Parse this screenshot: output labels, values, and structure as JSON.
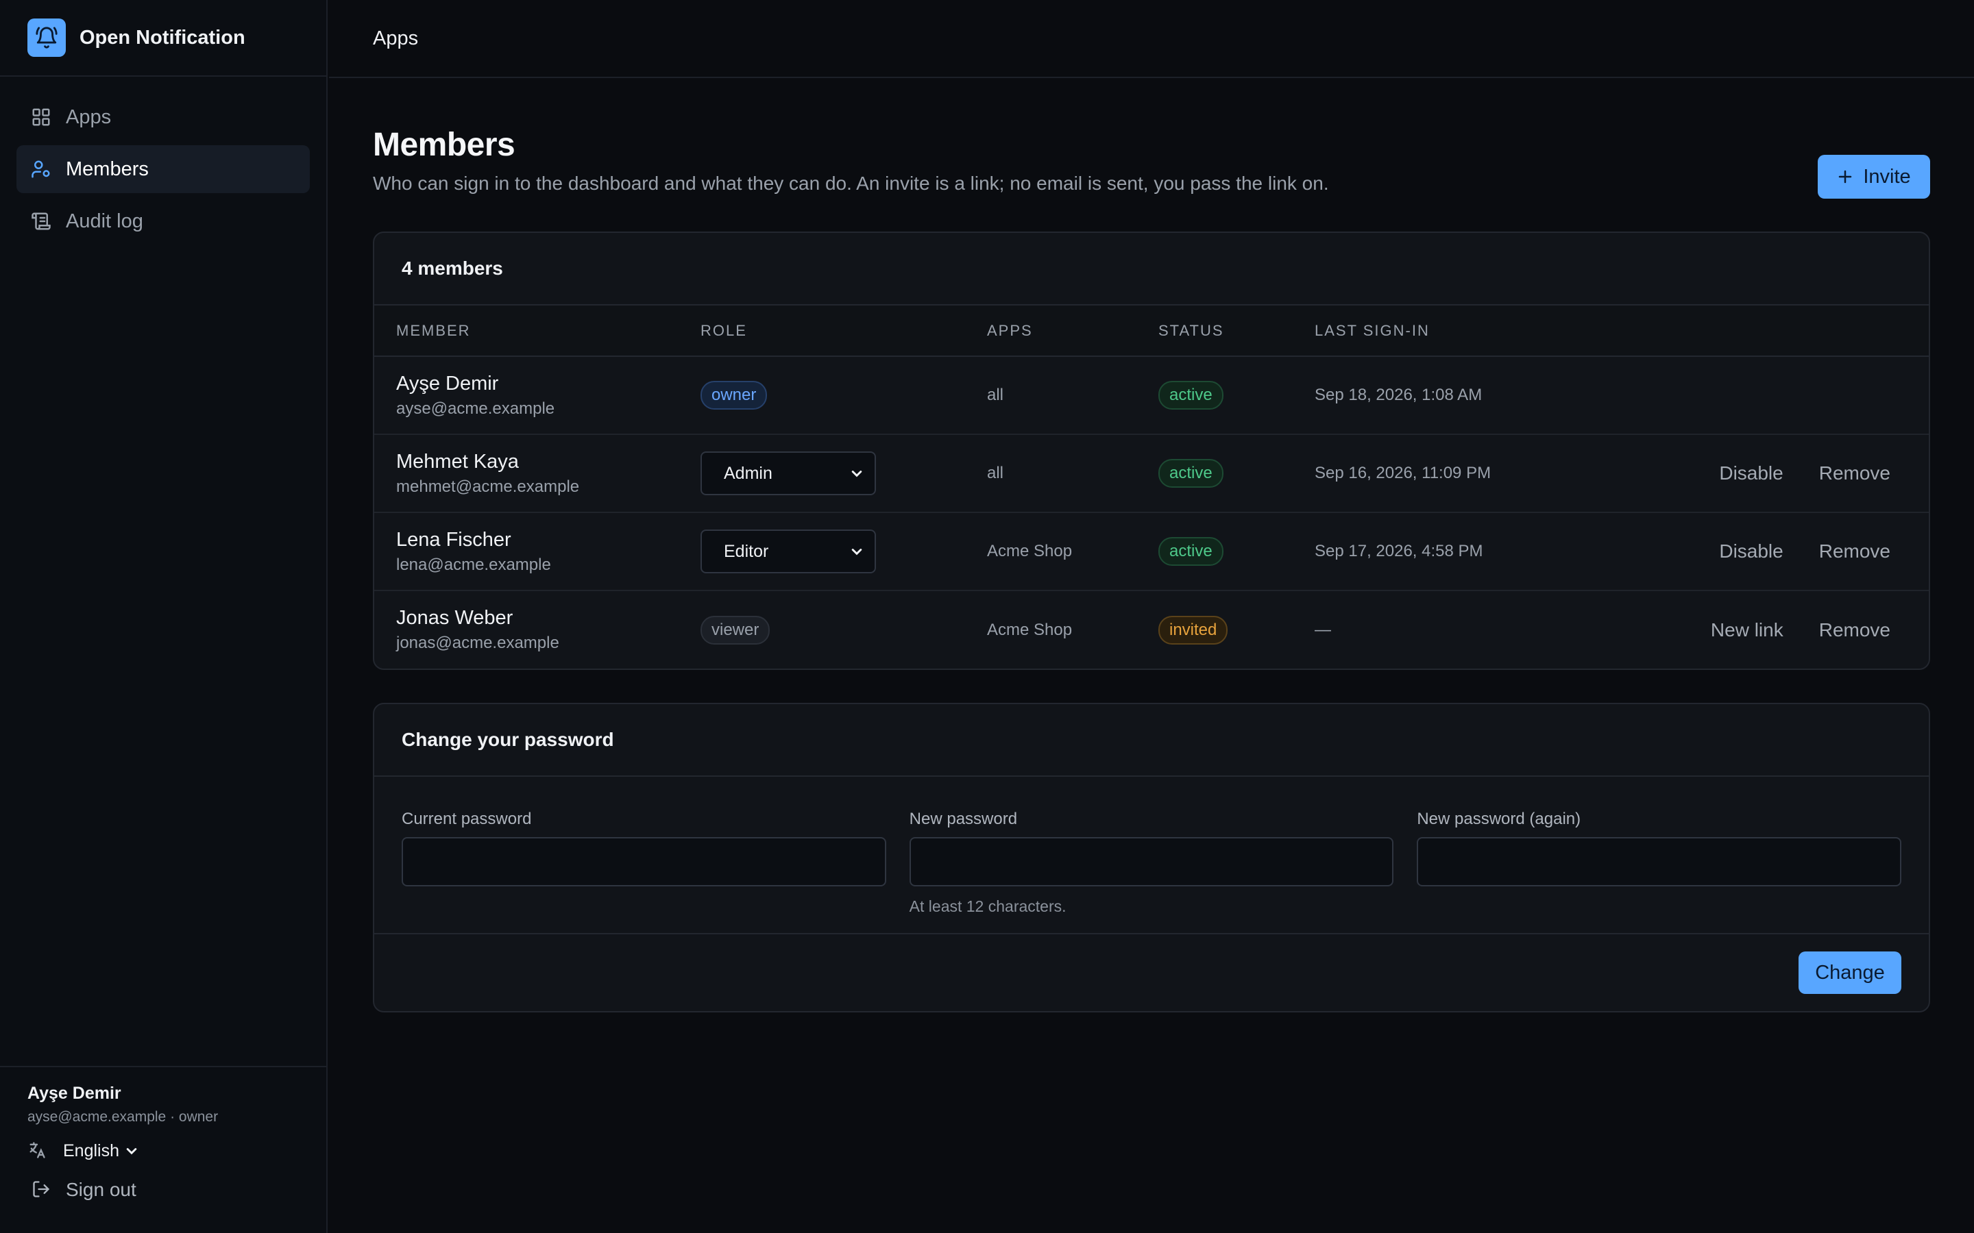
{
  "app": {
    "name": "Open Notification"
  },
  "sidebar": {
    "items": [
      {
        "label": "Apps",
        "icon": "grid-icon",
        "active": false
      },
      {
        "label": "Members",
        "icon": "users-icon",
        "active": true
      },
      {
        "label": "Audit log",
        "icon": "scroll-icon",
        "active": false
      }
    ],
    "user": {
      "name": "Ayşe Demir",
      "meta": "ayse@acme.example · owner"
    },
    "language": "English",
    "sign_out": "Sign out"
  },
  "topbar": {
    "breadcrumb": "Apps"
  },
  "page": {
    "title": "Members",
    "subtitle": "Who can sign in to the dashboard and what they can do. An invite is a link; no email is sent, you pass the link on.",
    "invite_label": "Invite"
  },
  "members": {
    "count_label": "4 members",
    "columns": [
      "MEMBER",
      "ROLE",
      "APPS",
      "STATUS",
      "LAST SIGN-IN"
    ],
    "rows": [
      {
        "name": "Ayşe Demir",
        "email": "ayse@acme.example",
        "role": "owner",
        "apps": "all",
        "status": "active",
        "last": "Sep 18, 2026, 1:08 AM",
        "action1": "",
        "action2": ""
      },
      {
        "name": "Mehmet Kaya",
        "email": "mehmet@acme.example",
        "role": "Admin",
        "apps": "all",
        "status": "active",
        "last": "Sep 16, 2026, 11:09 PM",
        "action1": "Disable",
        "action2": "Remove"
      },
      {
        "name": "Lena Fischer",
        "email": "lena@acme.example",
        "role": "Editor",
        "apps": "Acme Shop",
        "status": "active",
        "last": "Sep 17, 2026, 4:58 PM",
        "action1": "Disable",
        "action2": "Remove"
      },
      {
        "name": "Jonas Weber",
        "email": "jonas@acme.example",
        "role": "viewer",
        "apps": "Acme Shop",
        "status": "invited",
        "last": "—",
        "action1": "New link",
        "action2": "Remove"
      }
    ]
  },
  "password": {
    "title": "Change your password",
    "current_label": "Current password",
    "new_label": "New password",
    "again_label": "New password (again)",
    "hint": "At least 12 characters.",
    "submit": "Change"
  },
  "colors": {
    "accent": "#58a6ff",
    "active": "#4ec98a",
    "invited": "#e8a33d",
    "background": "#0a0c10"
  }
}
